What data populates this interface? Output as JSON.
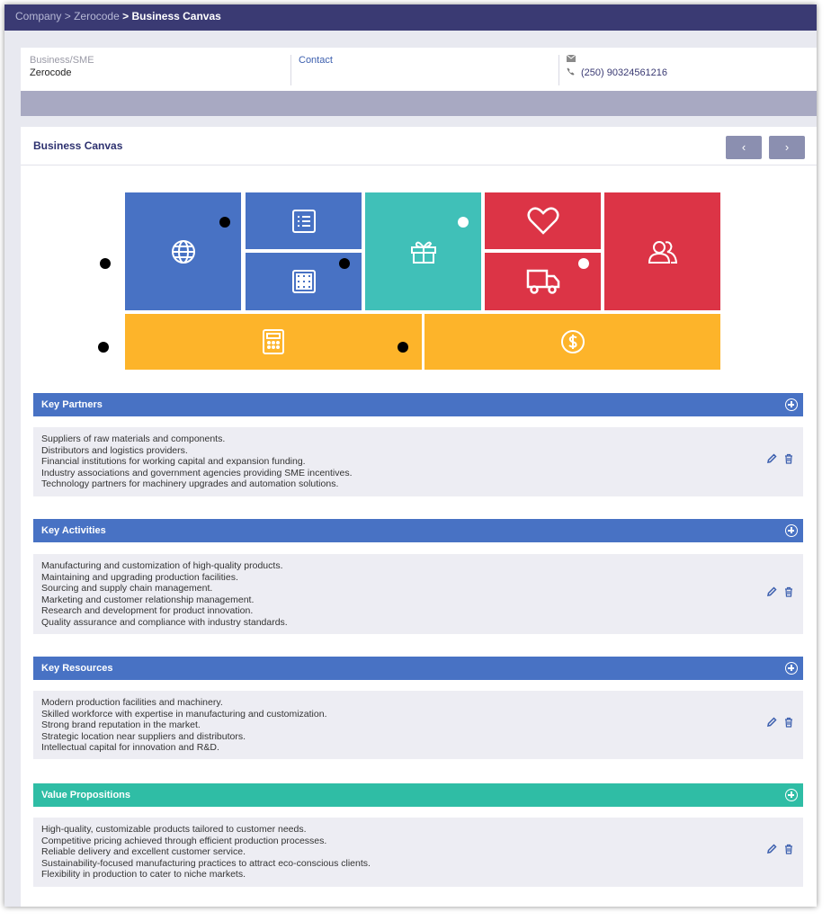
{
  "breadcrumb": {
    "items": [
      "Company",
      "Zerocode"
    ],
    "separator": ">",
    "current": "> Business Canvas"
  },
  "business": {
    "label": "Business/SME",
    "name": "Zerocode",
    "contact_link": "Contact",
    "phone": "(250) 90324561216",
    "email_icon": "mail-icon",
    "phone_icon": "phone-icon"
  },
  "canvas": {
    "title": "Business Canvas",
    "prev_label": "‹",
    "next_label": "›",
    "tile_icons": [
      "globe-icon",
      "list-icon",
      "grid-icon",
      "gift-icon",
      "heart-icon",
      "truck-icon",
      "users-icon",
      "calculator-icon",
      "dollar-icon"
    ],
    "colors": {
      "blue": "#4872c4",
      "teal": "#40c0b8",
      "red": "#dc3446",
      "amber": "#fdb42a",
      "navy": "#3a3a73",
      "dark": "#2e3270"
    }
  },
  "sections": [
    {
      "title": "Key Partners",
      "color": "#4872c4",
      "lines": [
        "Suppliers of raw materials and components.",
        "Distributors and logistics providers.",
        "Financial institutions for working capital and expansion funding.",
        "Industry associations and government agencies providing SME incentives.",
        "Technology partners for machinery upgrades and automation solutions."
      ]
    },
    {
      "title": "Key Activities",
      "color": "#4872c4",
      "lines": [
        "Manufacturing and customization of high-quality products.",
        "Maintaining and upgrading production facilities.",
        "Sourcing and supply chain management.",
        "Marketing and customer relationship management.",
        "Research and development for product innovation.",
        "Quality assurance and compliance with industry standards."
      ]
    },
    {
      "title": "Key Resources",
      "color": "#4872c4",
      "lines": [
        "Modern production facilities and machinery.",
        "Skilled workforce with expertise in manufacturing and customization.",
        "Strong brand reputation in the market.",
        "Strategic location near suppliers and distributors.",
        "Intellectual capital for innovation and R&D."
      ]
    },
    {
      "title": "Value Propositions",
      "color": "#2fbda5",
      "lines": [
        "High-quality, customizable products tailored to customer needs.",
        "Competitive pricing achieved through efficient production processes.",
        "Reliable delivery and excellent customer service.",
        "Sustainability-focused manufacturing practices to attract eco-conscious clients.",
        "Flexibility in production to cater to niche markets."
      ]
    }
  ]
}
